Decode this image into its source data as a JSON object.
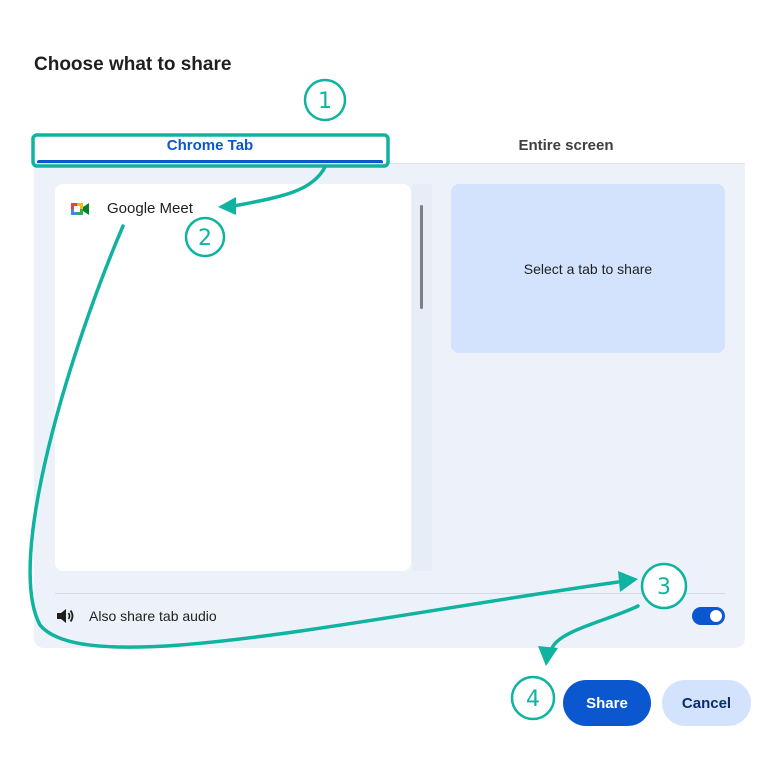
{
  "dialog": {
    "title": "Choose what to share"
  },
  "tabs": [
    {
      "label": "Chrome Tab",
      "selected": true
    },
    {
      "label": "Entire screen",
      "selected": false
    }
  ],
  "tab_list": {
    "items": [
      {
        "label": "Google Meet",
        "icon": "google-meet-icon"
      }
    ]
  },
  "preview": {
    "placeholder": "Select a tab to share"
  },
  "audio": {
    "label": "Also share tab audio",
    "enabled": true,
    "icon": "speaker-icon"
  },
  "actions": {
    "share_label": "Share",
    "cancel_label": "Cancel"
  },
  "annotations": {
    "steps": [
      "1",
      "2",
      "3",
      "4"
    ],
    "color": "#10b3a0"
  },
  "colors": {
    "accent": "#0b57d0",
    "panel_bg": "#edf2fa",
    "preview_bg": "#d3e3fd"
  }
}
